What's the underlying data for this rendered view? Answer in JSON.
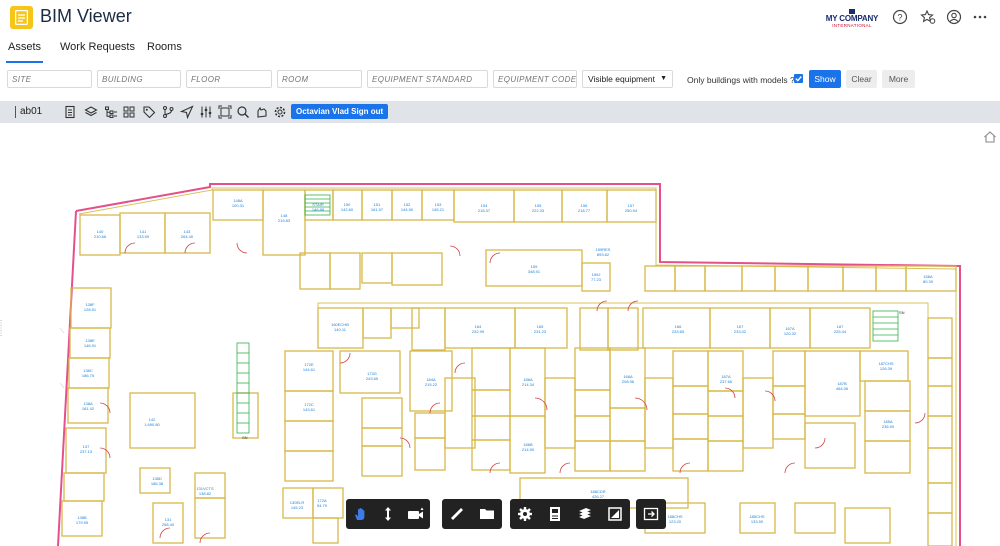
{
  "app": {
    "title": "BIM Viewer"
  },
  "brand": {
    "company": "MY COMPANY",
    "company_sub": "INTERNATIONAL",
    "accent": "#1a73e8",
    "logo_color": "#f5c518"
  },
  "header_icons": [
    "help-icon",
    "favorites-icon",
    "user-icon",
    "more-icon"
  ],
  "tabs": [
    {
      "label": "Assets",
      "active": true
    },
    {
      "label": "Work Requests",
      "active": false
    },
    {
      "label": "Rooms",
      "active": false
    }
  ],
  "filters": {
    "site": {
      "placeholder": "SITE",
      "value": ""
    },
    "building": {
      "placeholder": "BUILDING",
      "value": ""
    },
    "floor": {
      "placeholder": "FLOOR",
      "value": ""
    },
    "room": {
      "placeholder": "ROOM",
      "value": ""
    },
    "equipment_standard": {
      "placeholder": "EQUIPMENT STANDARD",
      "value": ""
    },
    "equipment_code": {
      "placeholder": "EQUIPMENT CODE",
      "value": ""
    },
    "visibility": {
      "selected": "Visible equipment"
    },
    "only_models_label": "Only buildings with models ?",
    "only_models_checked": true,
    "show_label": "Show",
    "clear_label": "Clear",
    "more_label": "More"
  },
  "viewer_toolbar": {
    "model": "ab01",
    "sign_out_label": "Octavian Vlad Sign out",
    "icons": [
      "sheets-icon",
      "layers-icon",
      "tree-icon",
      "grid-icon",
      "tag-icon",
      "branch-icon",
      "navigate-icon",
      "settings-sliders-icon",
      "fit-icon",
      "search-icon",
      "hand-sign-icon",
      "gear-icon"
    ]
  },
  "bottom_toolbar": {
    "groups": [
      [
        "pan-icon",
        "move-vertical-icon",
        "camera-icon"
      ],
      [
        "measure-icon",
        "folder-icon"
      ],
      [
        "settings-icon",
        "properties-icon",
        "layers-icon",
        "fullscreen-icon"
      ],
      [
        "export-icon"
      ]
    ]
  },
  "rooms": [
    {
      "id": "148A",
      "area": "100.31"
    },
    {
      "id": "148",
      "area": "219.83"
    },
    {
      "id": "STAIR",
      "area": "146.88"
    },
    {
      "id": "150",
      "area": "142.60"
    },
    {
      "id": "151",
      "area": "161.57"
    },
    {
      "id": "152",
      "area": "144.50"
    },
    {
      "id": "153",
      "area": "145.21"
    },
    {
      "id": "154",
      "area": "218.37"
    },
    {
      "id": "155",
      "area": "222.33"
    },
    {
      "id": "156",
      "area": "218.77"
    },
    {
      "id": "157",
      "area": "250.94"
    },
    {
      "id": "140",
      "area": "210.66"
    },
    {
      "id": "141",
      "area": "133.59"
    },
    {
      "id": "143",
      "area": "264.40"
    },
    {
      "id": "159RES",
      "area": "893.62"
    },
    {
      "id": "159",
      "area": "348.91"
    },
    {
      "id": "159J",
      "area": "77.23"
    },
    {
      "id": "158A",
      "area": "80.39"
    },
    {
      "id": "138F",
      "area": "128.51"
    },
    {
      "id": "138E",
      "area": "146.91"
    },
    {
      "id": "138C",
      "area": "186.75"
    },
    {
      "id": "138A",
      "area": "181.42"
    },
    {
      "id": "137",
      "area": "237.13"
    },
    {
      "id": "142",
      "area": "1,690.80"
    },
    {
      "id": "138D",
      "area": "186.38"
    },
    {
      "id": "138B",
      "area": "179.95"
    },
    {
      "id": "160ECHB",
      "area": "140.11"
    },
    {
      "id": "164",
      "area": "232.99"
    },
    {
      "id": "165",
      "area": "231.23"
    },
    {
      "id": "166",
      "area": "233.65"
    },
    {
      "id": "167",
      "area": "233.02"
    },
    {
      "id": "167A",
      "area": "120.32"
    },
    {
      "id": "187",
      "area": "225.44"
    },
    {
      "id": "172E",
      "area": "144.61"
    },
    {
      "id": "172C",
      "area": "143.61"
    },
    {
      "id": "173G",
      "area": "243.65"
    },
    {
      "id": "184A",
      "area": "215.22"
    },
    {
      "id": "186A",
      "area": "214.34"
    },
    {
      "id": "186B",
      "area": "214.50"
    },
    {
      "id": "166A",
      "area": "208.96"
    },
    {
      "id": "187A",
      "area": "237.66"
    },
    {
      "id": "187B",
      "area": "464.06"
    },
    {
      "id": "187CHS",
      "area": "126.39"
    },
    {
      "id": "185A",
      "area": "236.90"
    },
    {
      "id": "188CDR",
      "area": "426.27"
    },
    {
      "id": "188CHS",
      "area": "123.20"
    },
    {
      "id": "185CHS",
      "area": "133.50"
    },
    {
      "id": "131VCTS",
      "area": "138.82"
    },
    {
      "id": "131",
      "area": "258.40"
    },
    {
      "id": "130ELR",
      "area": "145.23"
    },
    {
      "id": "172A",
      "area": "54.79"
    }
  ]
}
